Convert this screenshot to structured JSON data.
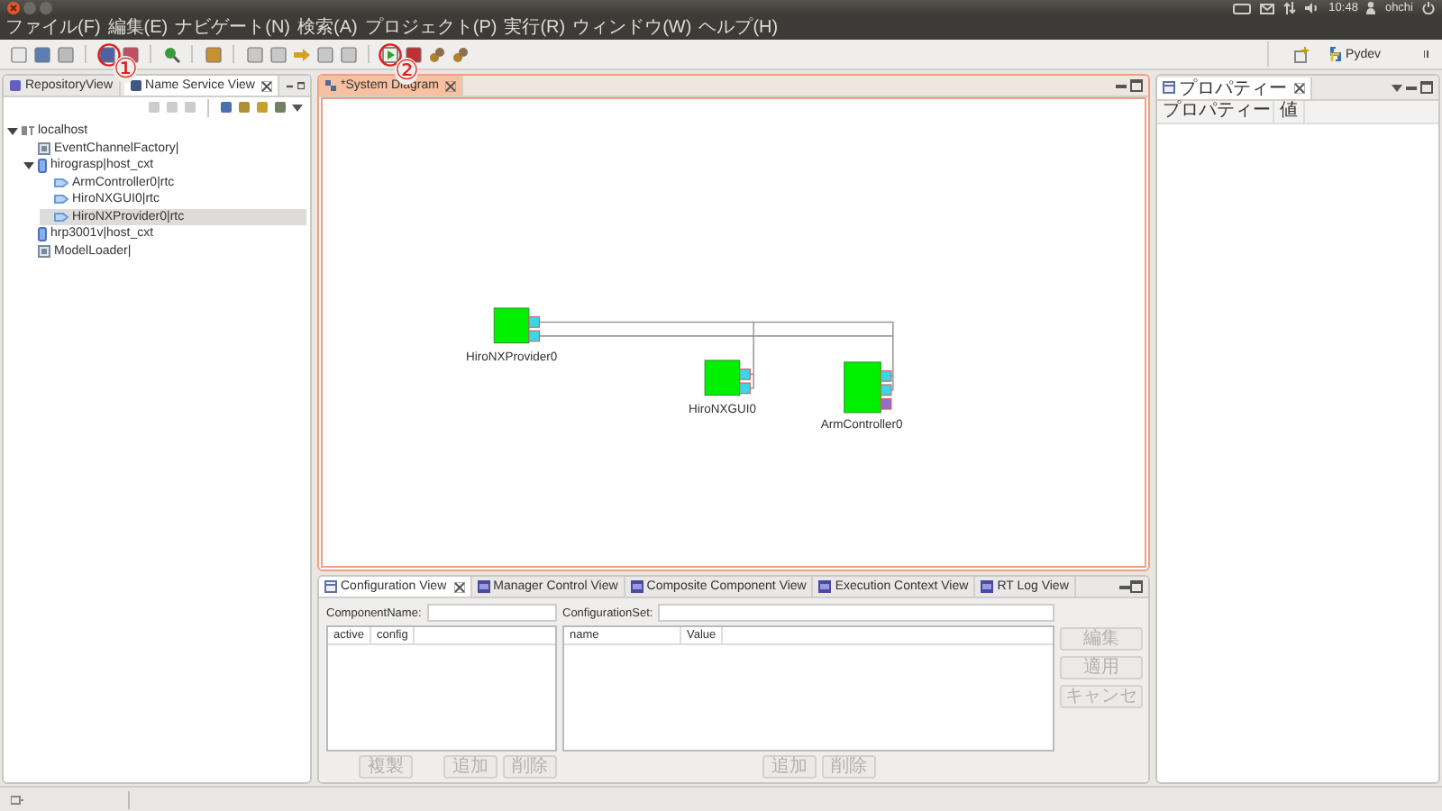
{
  "top_panel": {
    "time": "10:48",
    "user": "ohchi"
  },
  "menu": [
    "ファイル(F)",
    "編集(E)",
    "ナビゲート(N)",
    "検索(A)",
    "プロジェクト(P)",
    "実行(R)",
    "ウィンドウ(W)",
    "ヘルプ(H)"
  ],
  "annotations": [
    "①",
    "②"
  ],
  "perspective": {
    "label": "Pydev"
  },
  "left_panel": {
    "tabs": [
      {
        "label": "RepositoryView",
        "selected": false
      },
      {
        "label": "Name Service View",
        "selected": true
      }
    ],
    "tree": [
      {
        "label": "localhost",
        "kind": "host",
        "expanded": true,
        "selected": false,
        "children": [
          {
            "label": "EventChannelFactory|",
            "kind": "object",
            "selected": false
          },
          {
            "label": "hirograsp|host_cxt",
            "kind": "context",
            "expanded": true,
            "selected": false,
            "children": [
              {
                "label": "ArmController0|rtc",
                "kind": "component",
                "selected": false
              },
              {
                "label": "HiroNXGUI0|rtc",
                "kind": "component",
                "selected": false
              },
              {
                "label": "HiroNXProvider0|rtc",
                "kind": "component",
                "selected": true
              }
            ]
          },
          {
            "label": "hrp3001v|host_cxt",
            "kind": "context",
            "selected": false
          },
          {
            "label": "ModelLoader|",
            "kind": "object",
            "selected": false
          }
        ]
      }
    ]
  },
  "editor": {
    "tab": {
      "label": "*System Diagram",
      "selected": true
    },
    "components": [
      {
        "name": "HiroNXProvider0",
        "ports": [
          {
            "kind": "data"
          },
          {
            "kind": "data"
          }
        ]
      },
      {
        "name": "HiroNXGUI0",
        "ports": [
          {
            "kind": "data"
          },
          {
            "kind": "data"
          }
        ]
      },
      {
        "name": "ArmController0",
        "ports": [
          {
            "kind": "data"
          },
          {
            "kind": "data"
          },
          {
            "kind": "service"
          }
        ]
      }
    ]
  },
  "bottom_panel": {
    "tabs": [
      {
        "label": "Configuration View",
        "selected": true
      },
      {
        "label": "Manager Control View",
        "selected": false
      },
      {
        "label": "Composite Component View",
        "selected": false
      },
      {
        "label": "Execution Context View",
        "selected": false
      },
      {
        "label": "RT Log View",
        "selected": false
      }
    ],
    "component_name": {
      "label": "ComponentName:"
    },
    "configuration_set": {
      "label": "ConfigurationSet:"
    },
    "config_columns": [
      "active",
      "config"
    ],
    "set_columns": [
      "name",
      "Value"
    ],
    "config_buttons": [
      {
        "label": "複製",
        "disabled": true
      },
      {
        "label": "追加",
        "disabled": true
      },
      {
        "label": "削除",
        "disabled": true
      }
    ],
    "set_buttons": [
      {
        "label": "追加",
        "disabled": true
      },
      {
        "label": "削除",
        "disabled": true
      }
    ],
    "side_buttons": [
      {
        "label": "編集",
        "disabled": true
      },
      {
        "label": "適用",
        "disabled": true
      },
      {
        "label": "キャンセ",
        "disabled": true
      }
    ]
  },
  "right_panel": {
    "tab": {
      "label": "プロパティー",
      "selected": true
    },
    "columns": [
      "プロパティー",
      "値"
    ]
  }
}
